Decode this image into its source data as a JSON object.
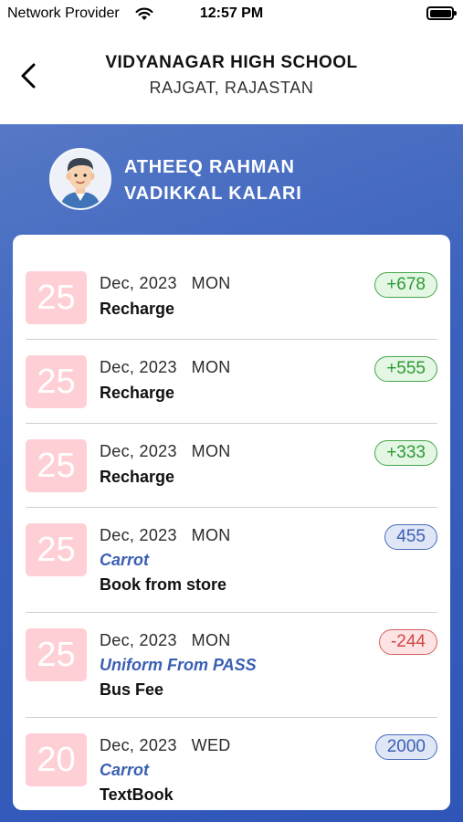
{
  "status_bar": {
    "carrier": "Network Provider",
    "time": "12:57 PM"
  },
  "header": {
    "title": "VIDYANAGAR HIGH SCHOOL",
    "subtitle": "RAJGAT, RAJASTAN"
  },
  "student": {
    "name_line1": "ATHEEQ RAHMAN",
    "name_line2": "VADIKKAL KALARI"
  },
  "colors": {
    "accent": "#3b62bd",
    "credit": "#2e9a34",
    "debit": "#d24646",
    "neutral": "#3b5fb5",
    "day_box": "#ffcfd6"
  },
  "transactions": [
    {
      "day": "25",
      "date": "Dec, 2023   MON",
      "description": "Recharge",
      "amount": "+678"
    },
    {
      "day": "25",
      "date": "Dec, 2023   MON",
      "description": "Recharge",
      "amount": "+555"
    },
    {
      "day": "25",
      "date": "Dec, 2023   MON",
      "description": "Recharge",
      "amount": "+333"
    },
    {
      "day": "25",
      "date": "Dec, 2023   MON",
      "category": "Carrot",
      "description": "Book from store",
      "amount": "455"
    },
    {
      "day": "25",
      "date": "Dec, 2023   MON",
      "category": "Uniform From PASS",
      "description": "Bus Fee",
      "amount": "-244"
    },
    {
      "day": "20",
      "date": "Dec, 2023   WED",
      "category": "Carrot",
      "description": "TextBook",
      "amount": "2000"
    }
  ]
}
